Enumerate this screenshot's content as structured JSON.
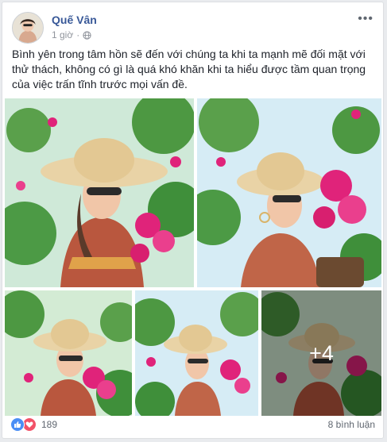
{
  "post": {
    "author": "Quế Vân",
    "time": "1 giờ",
    "more_icon": "ellipsis-icon",
    "privacy_icon": "globe-icon",
    "text": "Bình yên trong tâm hồn sẽ đến với chúng ta khi ta mạnh mẽ đối mặt với thử thách, không có gì là quá khó khăn khi ta hiểu được tầm quan trọng của việc trấn tĩnh trước mọi vấn đề."
  },
  "photos": {
    "more_count": "+4",
    "colors": {
      "sky": "#d9ecf7",
      "leaf": "#3f8f3a",
      "flower": "#e0237a",
      "hat": "#e9d3a6",
      "skin": "#f1c6a8"
    }
  },
  "footer": {
    "reaction_count": "189",
    "comments": "8 bình luận",
    "reaction_icons": [
      "like-icon",
      "love-icon"
    ]
  }
}
